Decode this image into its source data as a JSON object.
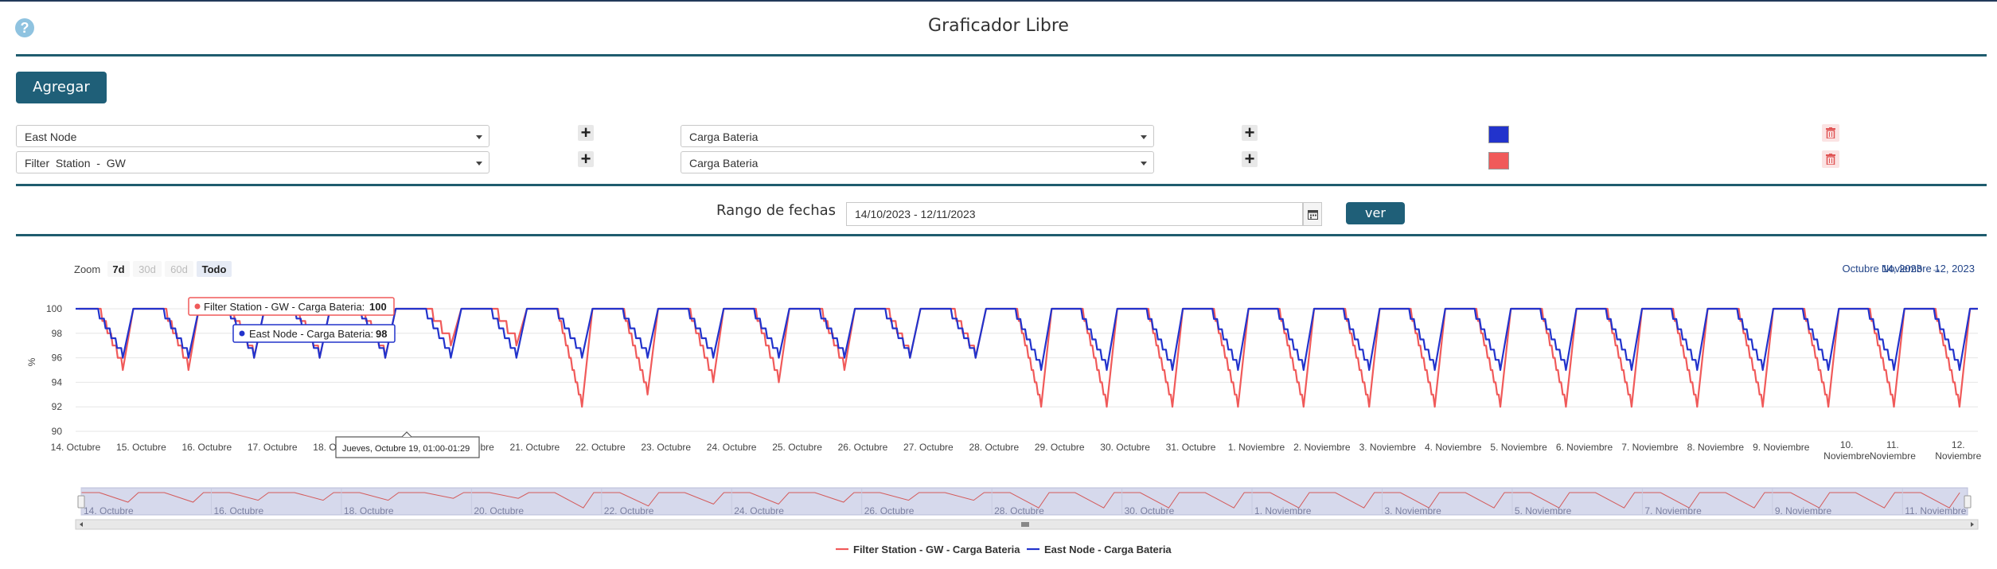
{
  "page": {
    "title": "Graficador Libre",
    "help_icon": "question-circle-icon"
  },
  "toolbar": {
    "add_label": "Agregar"
  },
  "rows": [
    {
      "device": "East Node",
      "variable": "Carga Bateria",
      "color": "#2233cc"
    },
    {
      "device": "Filter  Station  -  GW",
      "variable": "Carga Bateria",
      "color": "#f05a5a"
    }
  ],
  "date_range": {
    "label": "Rango de fechas",
    "value": "14/10/2023 - 12/11/2023",
    "button": "ver"
  },
  "zoom": {
    "label": "Zoom",
    "options": [
      "7d",
      "30d",
      "60d",
      "Todo"
    ],
    "active": "Todo",
    "disabled": [
      "30d",
      "60d"
    ]
  },
  "range_display": {
    "from": "Octubre 14, 2023",
    "arrow": "→",
    "to": "Noviembre 12, 2023"
  },
  "tooltip": {
    "header": "Jueves, Octubre 19, 01:00-01:29",
    "filter_label": "Filter Station - GW - Carga Bateria:",
    "filter_value": "100",
    "east_label": "East Node - Carga Bateria:",
    "east_value": "98"
  },
  "chart_data": {
    "type": "line",
    "title": "",
    "ylabel": "%",
    "ylim": [
      90,
      100
    ],
    "yticks": [
      "90",
      "92",
      "94",
      "96",
      "98",
      "100"
    ],
    "xticks": [
      "14. Octubre",
      "15. Octubre",
      "16. Octubre",
      "17. Octubre",
      "18. Octubre",
      "19. Octubre",
      "20. Octubre",
      "21. Octubre",
      "22. Octubre",
      "23. Octubre",
      "24. Octubre",
      "25. Octubre",
      "26. Octubre",
      "27. Octubre",
      "28. Octubre",
      "29. Octubre",
      "30. Octubre",
      "31. Octubre",
      "1. Noviembre",
      "2. Noviembre",
      "3. Noviembre",
      "4. Noviembre",
      "5. Noviembre",
      "6. Noviembre",
      "7. Noviembre",
      "8. Noviembre",
      "9. Noviembre",
      "10. Noviembre",
      "11. Noviembre",
      "12. Noviembre"
    ],
    "navigator_ticks": [
      "14. Octubre",
      "16. Octubre",
      "18. Octubre",
      "20. Octubre",
      "22. Octubre",
      "24. Octubre",
      "26. Octubre",
      "28. Octubre",
      "30. Octubre",
      "1. Noviembre",
      "3. Noviembre",
      "5. Noviembre",
      "7. Noviembre",
      "9. Noviembre",
      "11. Noviembre"
    ],
    "x_start": "14. Octubre",
    "daily_minimum": {
      "days": [
        "14. Octubre",
        "15. Octubre",
        "16. Octubre",
        "17. Octubre",
        "18. Octubre",
        "19. Octubre",
        "20. Octubre",
        "21. Octubre",
        "22. Octubre",
        "23. Octubre",
        "24. Octubre",
        "25. Octubre",
        "26. Octubre",
        "27. Octubre",
        "28. Octubre",
        "29. Octubre",
        "30. Octubre",
        "31. Octubre",
        "1. Noviembre",
        "2. Noviembre",
        "3. Noviembre",
        "4. Noviembre",
        "5. Noviembre",
        "6. Noviembre",
        "7. Noviembre",
        "8. Noviembre",
        "9. Noviembre",
        "10. Noviembre",
        "11. Noviembre"
      ]
    },
    "series": [
      {
        "name": "Filter Station - GW - Carga Bateria",
        "color": "#f05a5a",
        "daily_min": [
          95,
          95,
          96,
          96,
          96,
          97,
          97,
          92,
          93,
          94,
          94,
          95,
          96,
          96,
          92,
          92,
          92,
          92,
          92,
          92,
          92,
          92,
          92,
          92,
          92,
          92,
          92,
          92,
          92
        ],
        "max": 100
      },
      {
        "name": "East Node - Carga Bateria",
        "color": "#2233cc",
        "daily_min": [
          96,
          96,
          96,
          96,
          96,
          96,
          96,
          96,
          96,
          96,
          96,
          96,
          96,
          96,
          95,
          95,
          95,
          95,
          95,
          95,
          95,
          95,
          95,
          95,
          95,
          95,
          95,
          95,
          95
        ],
        "max": 100
      }
    ],
    "legend": [
      "Filter Station - GW - Carga Bateria",
      "East Node - Carga Bateria"
    ],
    "legend_position": "bottom-center",
    "grid": true
  }
}
